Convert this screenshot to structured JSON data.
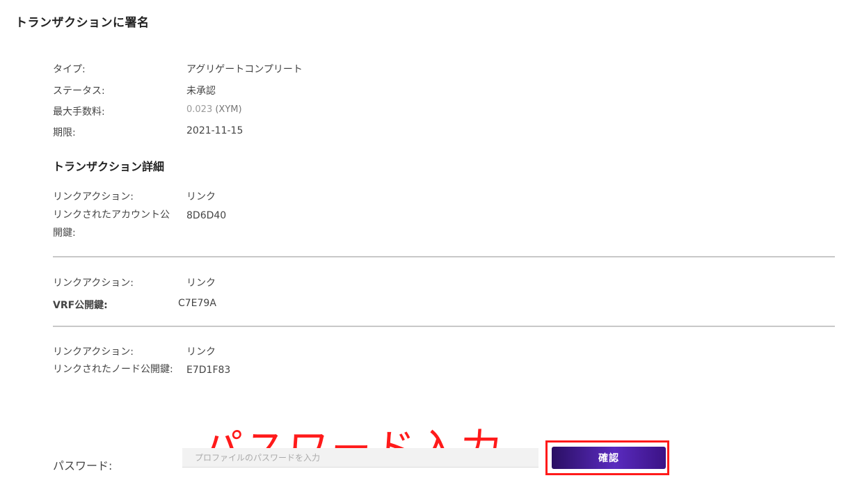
{
  "page_title": "トランザクションに署名",
  "summary": [
    {
      "label": "タイプ:",
      "value": "アグリゲートコンプリート"
    },
    {
      "label": "ステータス:",
      "value": "未承認"
    },
    {
      "label": "最大手数料:",
      "value_prefix": "0.023",
      "value_suffix": " (XYM)"
    },
    {
      "label": "期限:",
      "value": "2021-11-15"
    }
  ],
  "details_title": "トランザクション詳細",
  "details": [
    {
      "action_label": "リンクアクション:",
      "action_value": "リンク",
      "key_label": "リンクされたアカウント公開鍵:",
      "key_value": "8D6D40"
    },
    {
      "action_label": "リンクアクション:",
      "action_value": "リンク",
      "key_label": "VRF公開鍵:",
      "key_value": "C7E79A"
    },
    {
      "action_label": "リンクアクション:",
      "action_value": "リンク",
      "key_label": "リンクされたノード公開鍵:",
      "key_value": "E7D1F83"
    }
  ],
  "annotation": "パスワード入力",
  "password": {
    "label": "パスワード:",
    "placeholder": "プロファイルのパスワードを入力",
    "value": ""
  },
  "confirm_label": "確認",
  "colors": {
    "annotation": "#ff1a1a",
    "button": "#3b1285"
  }
}
